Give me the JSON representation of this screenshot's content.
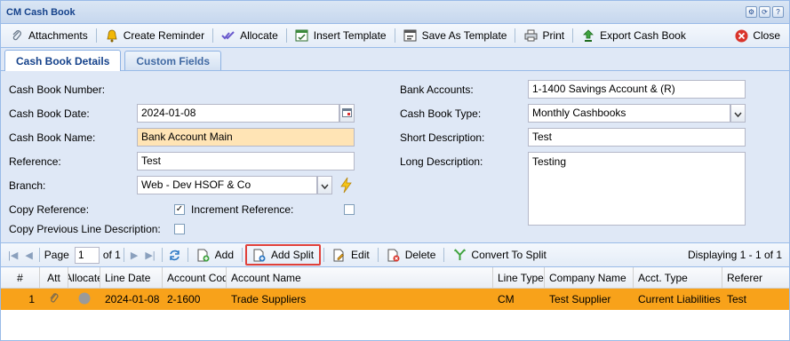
{
  "window": {
    "title": "CM Cash Book"
  },
  "toolbar": {
    "attachments": "Attachments",
    "create_reminder": "Create Reminder",
    "allocate": "Allocate",
    "insert_template": "Insert Template",
    "save_as_template": "Save As Template",
    "print": "Print",
    "export_cash_book": "Export Cash Book",
    "close": "Close"
  },
  "tabs": [
    {
      "label": "Cash Book Details",
      "active": true
    },
    {
      "label": "Custom Fields",
      "active": false
    }
  ],
  "form": {
    "cash_book_number": {
      "label": "Cash Book Number:",
      "value": ""
    },
    "cash_book_date": {
      "label": "Cash Book Date:",
      "value": "2024-01-08"
    },
    "cash_book_name": {
      "label": "Cash Book Name:",
      "value": "Bank Account Main"
    },
    "reference": {
      "label": "Reference:",
      "value": "Test"
    },
    "branch": {
      "label": "Branch:",
      "value": "Web - Dev HSOF & Co"
    },
    "copy_reference": {
      "label": "Copy Reference:",
      "checked": true
    },
    "increment_reference": {
      "label": "Increment Reference:",
      "checked": false
    },
    "copy_previous_line": {
      "label": "Copy Previous Line Description:",
      "checked": false
    },
    "bank_accounts": {
      "label": "Bank Accounts:",
      "value": "1-1400 Savings Account & (R)"
    },
    "cash_book_type": {
      "label": "Cash Book Type:",
      "value": "Monthly Cashbooks"
    },
    "short_description": {
      "label": "Short Description:",
      "value": "Test"
    },
    "long_description": {
      "label": "Long Description:",
      "value": "Testing"
    }
  },
  "grid_toolbar": {
    "page_label": "Page",
    "page_value": "1",
    "of_label": "of 1",
    "add": "Add",
    "add_split": "Add Split",
    "edit": "Edit",
    "delete": "Delete",
    "convert_to_split": "Convert To Split",
    "displaying": "Displaying 1 - 1 of 1"
  },
  "grid": {
    "columns": [
      "#",
      "Att",
      "Allocate",
      "Line Date",
      "Account Code",
      "Account Name",
      "Line Type",
      "Company Name",
      "Acct. Type",
      "Referer"
    ],
    "rows": [
      {
        "num": "1",
        "line_date": "2024-01-08",
        "account_code": "2-1600",
        "account_name": "Trade Suppliers",
        "line_type": "CM",
        "company_name": "Test Supplier",
        "acct_type": "Current Liabilities",
        "reference": "Test"
      }
    ]
  },
  "colors": {
    "selected_row": "#f8a21a",
    "header_text": "#15428b",
    "highlight": "#e0403a"
  }
}
